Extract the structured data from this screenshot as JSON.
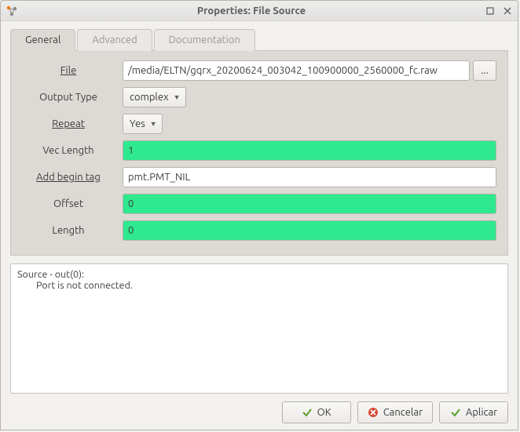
{
  "window": {
    "title": "Properties: File Source"
  },
  "tabs": {
    "general": "General",
    "advanced": "Advanced",
    "documentation": "Documentation"
  },
  "labels": {
    "file": "File",
    "output_type": "Output Type",
    "repeat": "Repeat",
    "vec_length": "Vec Length",
    "add_begin_tag": "Add begin tag",
    "offset": "Offset",
    "length": "Length"
  },
  "values": {
    "file": "/media/ELTN/gqrx_20200624_003042_100900000_2560000_fc.raw",
    "file_browse": "...",
    "output_type": "complex",
    "repeat": "Yes",
    "vec_length": "1",
    "add_begin_tag": "pmt.PMT_NIL",
    "offset": "0",
    "length": "0"
  },
  "log": {
    "line1": "Source - out(0):",
    "line2": "Port is not connected."
  },
  "buttons": {
    "ok": "OK",
    "cancel": "Cancelar",
    "apply": "Aplicar"
  }
}
